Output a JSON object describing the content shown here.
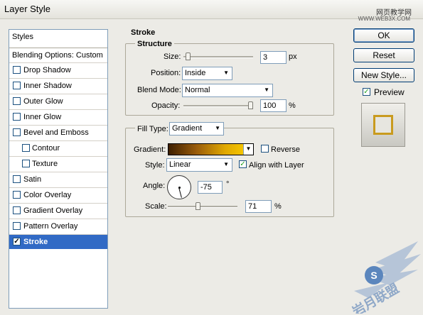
{
  "window": {
    "title": "Layer Style"
  },
  "watermark": {
    "line1": "网页教学网",
    "line2": "WWW.WEB3X.COM"
  },
  "styles_list": {
    "header": "Styles",
    "blending": "Blending Options: Custom",
    "items": [
      {
        "label": "Drop Shadow",
        "checked": false
      },
      {
        "label": "Inner Shadow",
        "checked": false
      },
      {
        "label": "Outer Glow",
        "checked": false
      },
      {
        "label": "Inner Glow",
        "checked": false
      },
      {
        "label": "Bevel and Emboss",
        "checked": false
      },
      {
        "label": "Contour",
        "checked": false
      },
      {
        "label": "Texture",
        "checked": false
      },
      {
        "label": "Satin",
        "checked": false
      },
      {
        "label": "Color Overlay",
        "checked": false
      },
      {
        "label": "Gradient Overlay",
        "checked": false
      },
      {
        "label": "Pattern Overlay",
        "checked": false
      },
      {
        "label": "Stroke",
        "checked": true
      }
    ]
  },
  "stroke": {
    "title": "Stroke",
    "structure": {
      "title": "Structure",
      "size_label": "Size:",
      "size_value": "3",
      "size_unit": "px",
      "size_level": 0.03,
      "position_label": "Position:",
      "position_value": "Inside",
      "blend_label": "Blend Mode:",
      "blend_value": "Normal",
      "opacity_label": "Opacity:",
      "opacity_value": "100",
      "opacity_unit": "%",
      "opacity_level": 1.0
    },
    "fill": {
      "type_label": "Fill Type:",
      "type_value": "Gradient",
      "gradient_label": "Gradient:",
      "reverse_label": "Reverse",
      "reverse_checked": false,
      "style_label": "Style:",
      "style_value": "Linear",
      "align_label": "Align with Layer",
      "align_checked": true,
      "angle_label": "Angle:",
      "angle_value": "-75",
      "angle_unit": "°",
      "scale_label": "Scale:",
      "scale_value": "71",
      "scale_unit": "%",
      "scale_level": 0.71
    }
  },
  "buttons": {
    "ok": "OK",
    "reset": "Reset",
    "new_style": "New Style...",
    "preview_label": "Preview",
    "preview_checked": true
  },
  "colors": {
    "selection": "#316ac5",
    "gradient_start": "#3c1e00",
    "gradient_end": "#ffd300",
    "stroke_preview": "#c99b1f"
  }
}
